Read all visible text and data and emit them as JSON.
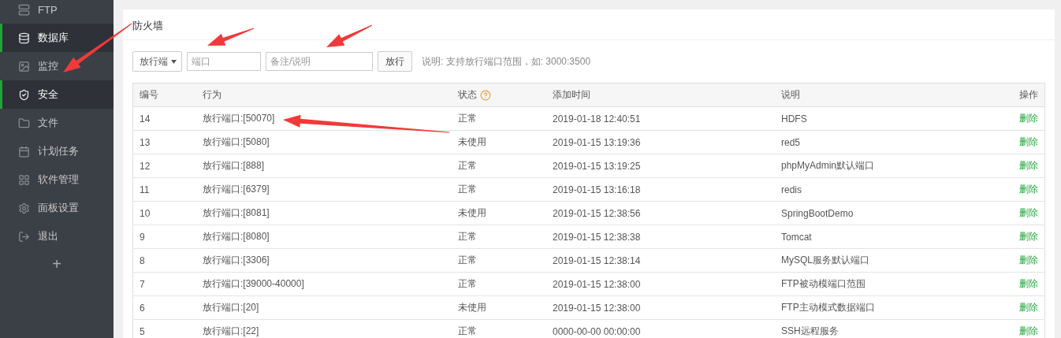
{
  "sidebar": {
    "items": [
      {
        "label": "FTP",
        "selected": false
      },
      {
        "label": "数据库",
        "selected": true
      },
      {
        "label": "监控",
        "selected": false
      },
      {
        "label": "安全",
        "selected": true
      },
      {
        "label": "文件",
        "selected": false
      },
      {
        "label": "计划任务",
        "selected": false
      },
      {
        "label": "软件管理",
        "selected": false
      },
      {
        "label": "面板设置",
        "selected": false
      },
      {
        "label": "退出",
        "selected": false
      }
    ],
    "add_button": "+"
  },
  "panel": {
    "title": "防火墙",
    "toolbar": {
      "select_value": "放行端",
      "port_field": {
        "placeholder": "端口"
      },
      "note_field": {
        "placeholder": "备注/说明"
      },
      "submit_button": "放行",
      "hint": "说明: 支持放行端口范围，如: 3000:3500"
    },
    "table": {
      "columns": [
        {
          "label": "编号",
          "help": false
        },
        {
          "label": "行为",
          "help": false
        },
        {
          "label": "状态",
          "help": true
        },
        {
          "label": "添加时间",
          "help": false
        },
        {
          "label": "说明",
          "help": false
        },
        {
          "label": "操作",
          "help": false
        }
      ],
      "rows": [
        {
          "id": "14",
          "action": "放行端口:[50070]",
          "status": "正常",
          "added": "2019-01-18 12:40:51",
          "note": "HDFS",
          "op": "删除"
        },
        {
          "id": "13",
          "action": "放行端口:[5080]",
          "status": "未使用",
          "added": "2019-01-15 13:19:36",
          "note": "red5",
          "op": "删除"
        },
        {
          "id": "12",
          "action": "放行端口:[888]",
          "status": "正常",
          "added": "2019-01-15 13:19:25",
          "note": "phpMyAdmin默认端口",
          "op": "删除"
        },
        {
          "id": "11",
          "action": "放行端口:[6379]",
          "status": "正常",
          "added": "2019-01-15 13:16:18",
          "note": "redis",
          "op": "删除"
        },
        {
          "id": "10",
          "action": "放行端口:[8081]",
          "status": "未使用",
          "added": "2019-01-15 12:38:56",
          "note": "SpringBootDemo",
          "op": "删除"
        },
        {
          "id": "9",
          "action": "放行端口:[8080]",
          "status": "正常",
          "added": "2019-01-15 12:38:38",
          "note": "Tomcat",
          "op": "删除"
        },
        {
          "id": "8",
          "action": "放行端口:[3306]",
          "status": "正常",
          "added": "2019-01-15 12:38:14",
          "note": "MySQL服务默认端口",
          "op": "删除"
        },
        {
          "id": "7",
          "action": "放行端口:[39000-40000]",
          "status": "正常",
          "added": "2019-01-15 12:38:00",
          "note": "FTP被动模端口范围",
          "op": "删除"
        },
        {
          "id": "6",
          "action": "放行端口:[20]",
          "status": "未使用",
          "added": "2019-01-15 12:38:00",
          "note": "FTP主动模式数据端口",
          "op": "删除"
        },
        {
          "id": "5",
          "action": "放行端口:[22]",
          "status": "正常",
          "added": "0000-00-00 00:00:00",
          "note": "SSH远程服务",
          "op": "删除"
        }
      ]
    }
  }
}
